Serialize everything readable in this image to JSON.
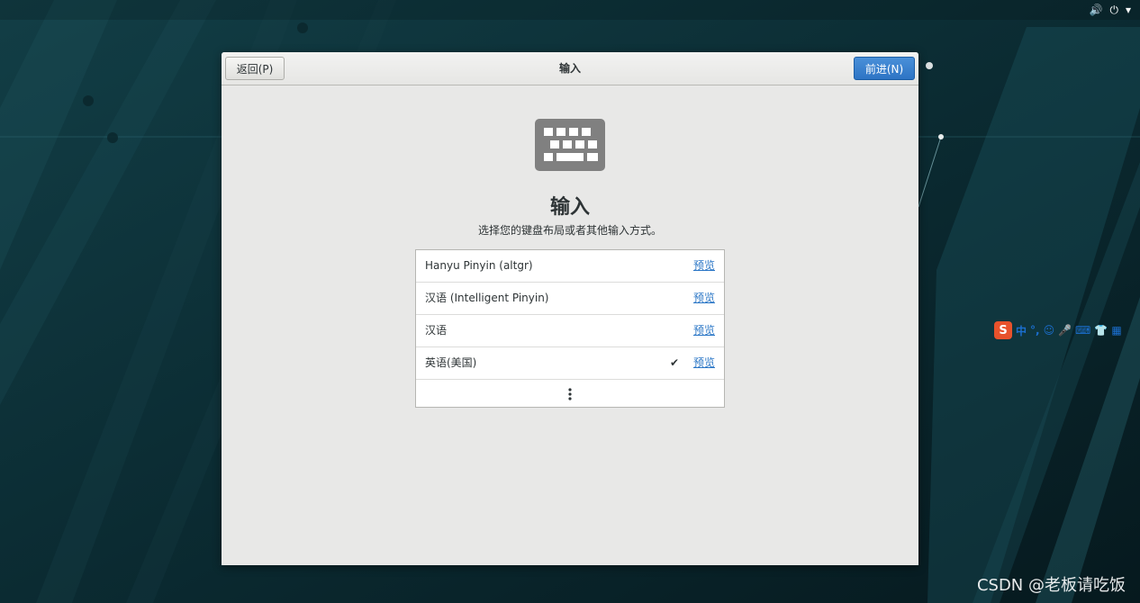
{
  "tray": {
    "volume_glyph": "🔊",
    "power_glyph": "⏻",
    "menu_glyph": "▾"
  },
  "dialog": {
    "back_label": "返回(P)",
    "title": "输入",
    "next_label": "前进(N)"
  },
  "page": {
    "heading": "输入",
    "subtitle": "选择您的键盘布局或者其他输入方式。"
  },
  "input_sources": [
    {
      "label": "Hanyu Pinyin (altgr)",
      "selected": false,
      "preview_label": "预览"
    },
    {
      "label": "汉语 (Intelligent Pinyin)",
      "selected": false,
      "preview_label": "预览"
    },
    {
      "label": "汉语",
      "selected": false,
      "preview_label": "预览"
    },
    {
      "label": "英语(美国)",
      "selected": true,
      "preview_label": "预览",
      "check_glyph": "✔"
    }
  ],
  "ime_toolbar": {
    "logo": "S",
    "mode": "中",
    "punct": "°,",
    "emoji": "☺",
    "voice": "🎤",
    "keyboard": "⌨",
    "skin": "👕",
    "apps": "▦"
  },
  "watermark": "CSDN @老板请吃饭",
  "colors": {
    "accent": "#2d74c4",
    "link": "#2a76c6",
    "background": "#0c2f36"
  }
}
